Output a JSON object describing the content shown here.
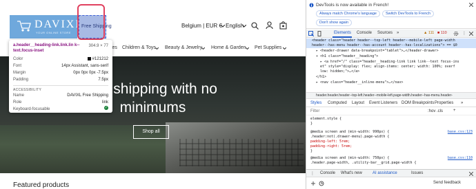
{
  "site": {
    "logo": {
      "text": "DAVIXL",
      "subtext": "YOUR ONLINE STORE",
      "hover_label": "Free Shipping"
    },
    "header": {
      "currency": "Belgium | EUR €",
      "language": "English"
    },
    "nav": [
      "Supplies",
      "Children & Toys",
      "Beauty & Jewelry",
      "Home & Garden",
      "Pet Supplies"
    ],
    "hero": {
      "line1": "ree shipping with no",
      "line2": "minimums",
      "button": "Shop all"
    },
    "section_title": "Featured products"
  },
  "tooltip": {
    "selector": "a.header__heading-link.link.lin k--text.focus-inset",
    "size": "304.9 × 77",
    "rows": [
      {
        "k": "Color",
        "v": "#121212"
      },
      {
        "k": "Font",
        "v": "14px Assistant, sans-serif"
      },
      {
        "k": "Margin",
        "v": "0px 0px 0px -7.5px"
      },
      {
        "k": "Padding",
        "v": "7.5px"
      }
    ],
    "accessibility_label": "ACCESSIBILITY",
    "acc_rows": [
      {
        "k": "Name",
        "v": "DAVIXL Free Shipping"
      },
      {
        "k": "Role",
        "v": "link"
      },
      {
        "k": "Keyboard-focusable",
        "v": ""
      }
    ]
  },
  "devtools": {
    "notice": "DevTools is now available in French!",
    "chips": [
      "Always match Chrome's language",
      "Switch DevTools to French",
      "Don't show again"
    ],
    "tabs": [
      "Elements",
      "Console",
      "Sources"
    ],
    "warnings": "111",
    "errors": "110",
    "code_lines": [
      "<header class=\"header header--top-left header--mobile-left page-width",
      "header--has-menu header--has-account header--has-localizations\"> == $0",
      "▸ <header-drawer data-breakpoint=\"tablet\">…</header-drawer>",
      "▾ <h1 class=\"header__heading\">",
      "▸ <a href=\"/\" class=\"header__heading-link link link--text focus-ins",
      "et\" style=\"display: flex; align-items: center; width: 100%; overf",
      "low: hidden;\">…</a>",
      "</h1>",
      "▸ <nav class=\"header__inline-menu\">…</nav>"
    ],
    "breadcrumb": "header.header.header--top-left.header--mobile-left.page-width.header--has-menu.header-",
    "subtabs": [
      "Styles",
      "Computed",
      "Layout",
      "Event Listeners",
      "DOM Breakpoints",
      "Properties"
    ],
    "filter_placeholder": "Filter",
    "filter_right": ":hov .cls",
    "style_lines": [
      {
        "t": "element.style {",
        "src": ""
      },
      {
        "t": "}",
        "src": ""
      },
      {
        "t": "@media screen and (min-width: 990px) {",
        "src": "base.css:123"
      },
      {
        "t": ".header:not(.drawer-menu).page-width {",
        "src": ""
      },
      {
        "t": "  padding-left: 5rem;",
        "src": ""
      },
      {
        "t": "  padding-right: 5rem;",
        "src": ""
      },
      {
        "t": "}",
        "src": ""
      },
      {
        "t": "@media screen and (min-width: 750px) {",
        "src": "base.css:110"
      },
      {
        "t": ".header.page-width, .utility-bar__grid.page-width {",
        "src": ""
      }
    ],
    "drawer_tabs": [
      "Console",
      "What's new",
      "AI assistance",
      "Issues"
    ],
    "footer_left": "",
    "footer_right": "Send feedback"
  }
}
